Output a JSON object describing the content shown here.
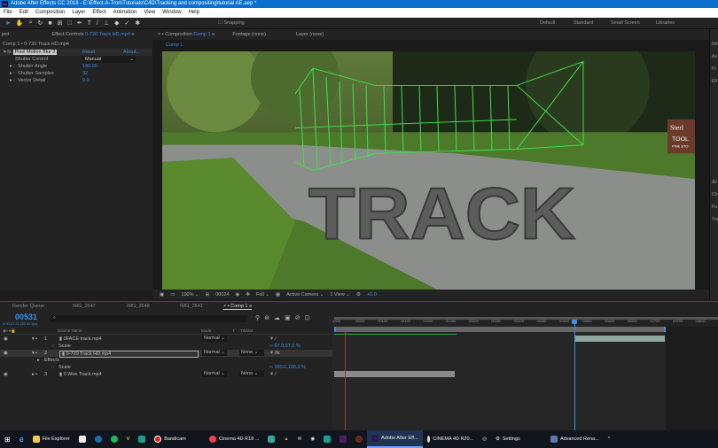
{
  "window": {
    "title": "Adobe After Effects CC 2018 - E:\\Effect-A-Tron\\Tutorials\\C4D\\Tracking and compositing\\tutorial AE.aep *",
    "app_icon": "Ae"
  },
  "menu": [
    "File",
    "Edit",
    "Composition",
    "Layer",
    "Effect",
    "Animation",
    "View",
    "Window",
    "Help"
  ],
  "toolbar": {
    "snapping": "Snapping",
    "workspaces": [
      "Default",
      "Standard",
      "Small Screen",
      "Libraries"
    ]
  },
  "effect_controls": {
    "project_tab": "ject",
    "tab_label": "Effect Controls",
    "tab_layer": "0-720 Track HD.mp4",
    "breadcrumb": "Comp 1 • 0-720 Track HD.mp4",
    "effect_name": "Pixel Motion Blur 2",
    "reset": "Reset",
    "about": "About...",
    "props": [
      {
        "label": "Shutter Control",
        "value": "Manual"
      },
      {
        "label": "Shutter Angle",
        "value": "180.00"
      },
      {
        "label": "Shutter Samples",
        "value": "32"
      },
      {
        "label": "Vector Detail",
        "value": "5.0"
      }
    ]
  },
  "composition": {
    "tab_label": "Composition",
    "tab_comp": "Comp 1",
    "footage": "Footage (none)",
    "layer": "Layer (none)",
    "comp_chip": "Comp 1",
    "scene_text": "TRACK",
    "sign_text": [
      "Sterl",
      "TOOL",
      "PINE STO"
    ]
  },
  "viewer_controls": {
    "zoom": "100%",
    "frame": "00024",
    "resolution": "Full",
    "camera": "Active Camera",
    "views": "1 View",
    "exposure": "+0.0"
  },
  "right_panel": [
    "Info",
    "Au",
    "Pr",
    "Eff",
    "Ali",
    "Ch",
    "Pa",
    "Tra"
  ],
  "timeline": {
    "tabs": [
      "Render Queue",
      "IMG_2647",
      "IMG_2648",
      "IMG_2641",
      "Comp 1"
    ],
    "current_time": "00531",
    "time_sub": "0:00:17:21 (30.00 fps)",
    "columns": {
      "source": "Source Name",
      "mode": "Mode",
      "t": "T",
      "trkmat": "TrkMat"
    },
    "layers": [
      {
        "num": "1",
        "name": "0FACE track.mp4",
        "mode": "Normal",
        "trkmat": "",
        "sub": [
          {
            "label": "Scale",
            "value": "67.0,67.0 %"
          }
        ]
      },
      {
        "num": "2",
        "name": "0-720 Track HD.mp4",
        "mode": "Normal",
        "trkmat": "None",
        "sub": [
          {
            "label": "Effects",
            "value": ""
          },
          {
            "label": "Scale",
            "value": "100.0,100.0 %"
          }
        ]
      },
      {
        "num": "3",
        "name": "0 Wire Track.mp4",
        "mode": "Normal",
        "trkmat": "None",
        "sub": []
      }
    ],
    "ruler": [
      "0000",
      "00050",
      "00100",
      "00150",
      "00200",
      "00250",
      "00300",
      "00350",
      "00400",
      "00450",
      "00500",
      "00550",
      "00600",
      "00650",
      "00700",
      "00750",
      "00800"
    ]
  },
  "taskbar": [
    "File Explorer",
    "Bandicam",
    "Cinema 4D R18 ...",
    "Adobe After Eff...",
    "CINEMA 4D R20...",
    "Settings",
    "Advanced Rena..."
  ]
}
